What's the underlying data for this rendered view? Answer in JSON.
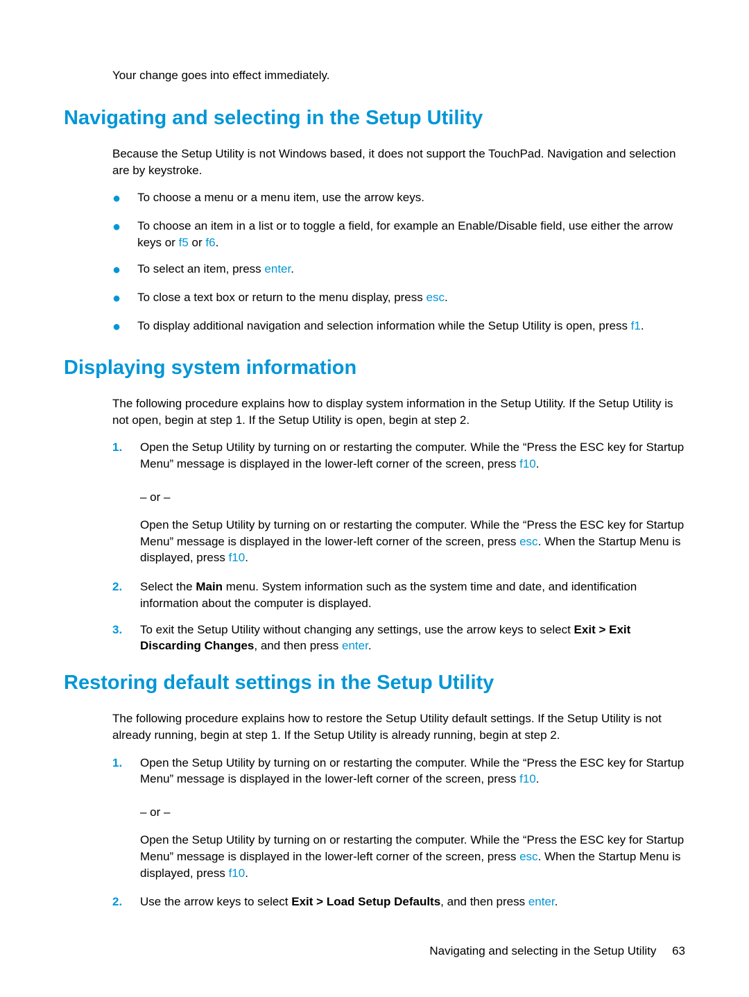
{
  "intro": "Your change goes into effect immediately.",
  "section1": {
    "heading": "Navigating and selecting in the Setup Utility",
    "body": "Because the Setup Utility is not Windows based, it does not support the TouchPad. Navigation and selection are by keystroke.",
    "bullets": {
      "b1": "To choose a menu or a menu item, use the arrow keys.",
      "b2a": "To choose an item in a list or to toggle a field, for example an Enable/Disable field, use either the arrow keys or ",
      "b2_f5": "f5",
      "b2_or": " or ",
      "b2_f6": "f6",
      "b2_end": ".",
      "b3a": "To select an item, press ",
      "b3_enter": "enter",
      "b3_end": ".",
      "b4a": "To close a text box or return to the menu display, press ",
      "b4_esc": "esc",
      "b4_end": ".",
      "b5a": "To display additional navigation and selection information while the Setup Utility is open, press ",
      "b5_f1": "f1",
      "b5_end": "."
    }
  },
  "section2": {
    "heading": "Displaying system information",
    "body": "The following procedure explains how to display system information in the Setup Utility. If the Setup Utility is not open, begin at step 1. If the Setup Utility is open, begin at step 2.",
    "step1a": "Open the Setup Utility by turning on or restarting the computer. While the “Press the ESC key for Startup Menu” message is displayed in the lower-left corner of the screen, press ",
    "step1_f10": "f10",
    "step1_end": ".",
    "or": "– or –",
    "step1b_a": "Open the Setup Utility by turning on or restarting the computer. While the “Press the ESC key for Startup Menu” message is displayed in the lower-left corner of the screen, press ",
    "step1b_esc": "esc",
    "step1b_mid": ". When the Startup Menu is displayed, press ",
    "step1b_f10": "f10",
    "step1b_end": ".",
    "step2a": "Select the ",
    "step2_main": "Main",
    "step2b": " menu. System information such as the system time and date, and identification information about the computer is displayed.",
    "step3a": "To exit the Setup Utility without changing any settings, use the arrow keys to select ",
    "step3_exit": "Exit > Exit Discarding Changes",
    "step3b": ", and then press ",
    "step3_enter": "enter",
    "step3_end": "."
  },
  "section3": {
    "heading": "Restoring default settings in the Setup Utility",
    "body": "The following procedure explains how to restore the Setup Utility default settings. If the Setup Utility is not already running, begin at step 1. If the Setup Utility is already running, begin at step 2.",
    "step1a": "Open the Setup Utility by turning on or restarting the computer. While the “Press the ESC key for Startup Menu” message is displayed in the lower-left corner of the screen, press ",
    "step1_f10": "f10",
    "step1_end": ".",
    "or": "– or –",
    "step1b_a": "Open the Setup Utility by turning on or restarting the computer. While the “Press the ESC key for Startup Menu” message is displayed in the lower-left corner of the screen, press ",
    "step1b_esc": "esc",
    "step1b_mid": ". When the Startup Menu is displayed, press ",
    "step1b_f10": "f10",
    "step1b_end": ".",
    "step2a": "Use the arrow keys to select ",
    "step2_exit": "Exit > Load Setup Defaults",
    "step2b": ", and then press ",
    "step2_enter": "enter",
    "step2_end": "."
  },
  "footer": {
    "title": "Navigating and selecting in the Setup Utility",
    "pagenum": "63"
  },
  "markers": {
    "n1": "1.",
    "n2": "2.",
    "n3": "3."
  }
}
